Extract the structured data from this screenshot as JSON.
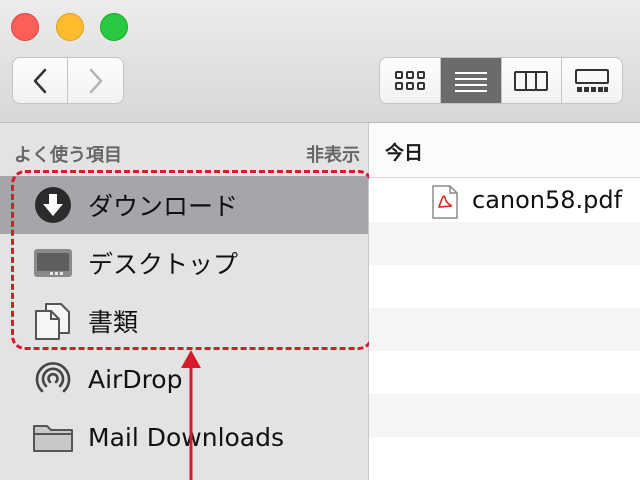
{
  "toolbar": {
    "traffic_lights": [
      "close-icon",
      "minimize-icon",
      "zoom-icon"
    ],
    "nav": {
      "back_icon": "chevron-left-icon",
      "forward_icon": "chevron-right-icon"
    },
    "view_modes": [
      {
        "icon": "icon-view-icon",
        "active": false
      },
      {
        "icon": "list-view-icon",
        "active": true
      },
      {
        "icon": "column-view-icon",
        "active": false
      },
      {
        "icon": "gallery-view-icon",
        "active": false
      }
    ]
  },
  "sidebar": {
    "section_title": "よく使う項目",
    "hide_label": "非表示",
    "items": [
      {
        "label": "ダウンロード",
        "icon": "download-icon",
        "selected": true
      },
      {
        "label": "デスクトップ",
        "icon": "desktop-icon",
        "selected": false
      },
      {
        "label": "書類",
        "icon": "documents-icon",
        "selected": false
      },
      {
        "label": "AirDrop",
        "icon": "airdrop-icon",
        "selected": false
      },
      {
        "label": "Mail Downloads",
        "icon": "folder-icon",
        "selected": false
      }
    ]
  },
  "filelist": {
    "group_header": "今日",
    "files": [
      {
        "name": "canon58.pdf",
        "icon": "pdf-icon"
      }
    ]
  },
  "annotation": {
    "highlight_color": "#d61b2d",
    "arrow_color": "#d61b2d"
  },
  "colors": {
    "selected_row": "#a6a5aa",
    "active_view": "#6b6b6b"
  }
}
